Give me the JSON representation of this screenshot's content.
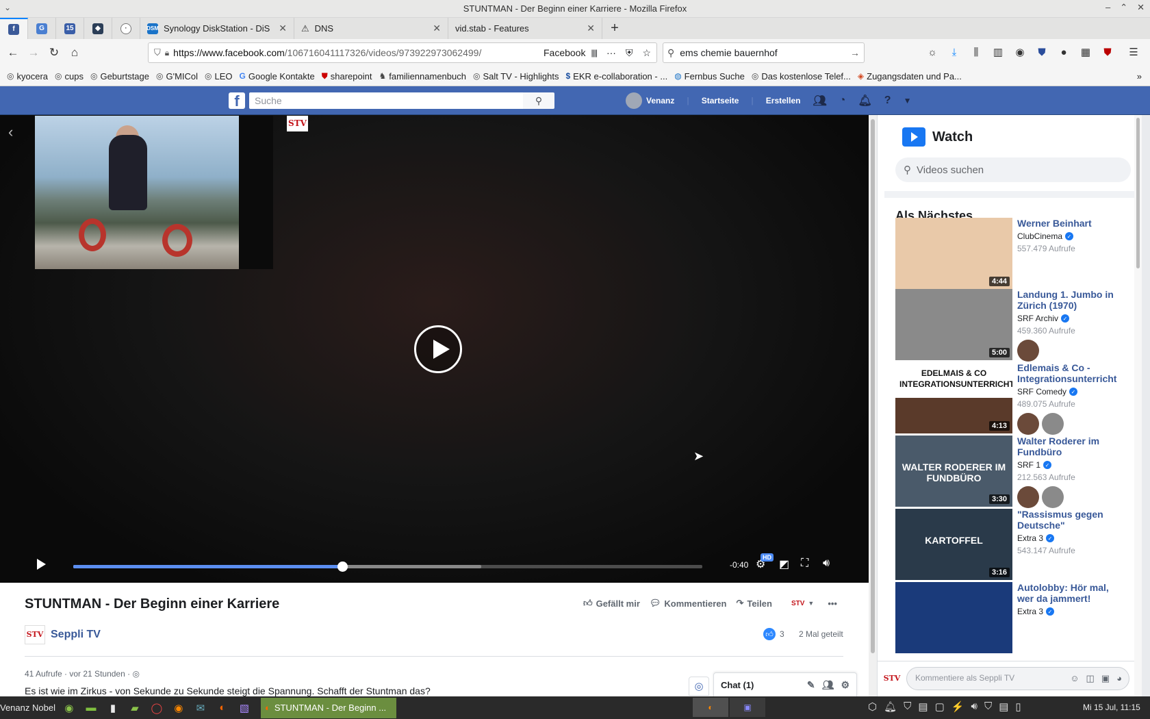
{
  "window": {
    "title": "STUNTMAN - Der Beginn einer Karriere - Mozilla Firefox"
  },
  "tabs": [
    {
      "label": "Synology DiskStation - DiS",
      "close": "✕"
    },
    {
      "label": "DNS",
      "close": "✕"
    },
    {
      "label": "vid.stab - Features",
      "close": "✕"
    }
  ],
  "pinned_tabs": [
    {
      "icon": "facebook-icon",
      "glyph": "f",
      "color": "#3b5998"
    },
    {
      "icon": "gs-icon",
      "glyph": "G",
      "color": "#4a7fd1"
    },
    {
      "icon": "calendar-icon",
      "glyph": "15",
      "color": "#3a5ea8"
    },
    {
      "icon": "codeberg-icon",
      "glyph": "◆",
      "color": "#2b3e57"
    },
    {
      "icon": "globe-icon",
      "glyph": "◎",
      "color": "#666666"
    }
  ],
  "navbar": {
    "url_host": "https://www.facebook.com",
    "url_path": "/106716041117326/videos/973922973062499/",
    "site_label": "Facebook",
    "search_value": "ems chemie bauernhof"
  },
  "bookmarks": [
    {
      "label": "kyocera"
    },
    {
      "label": "cups"
    },
    {
      "label": "Geburtstage"
    },
    {
      "label": "G'MICol"
    },
    {
      "label": "LEO"
    },
    {
      "label": "Google Kontakte"
    },
    {
      "label": "sharepoint"
    },
    {
      "label": "familiennamenbuch"
    },
    {
      "label": "Salt TV - Highlights"
    },
    {
      "label": "EKR e-collaboration - ..."
    },
    {
      "label": "Fernbus Suche"
    },
    {
      "label": "Das kostenlose Telef..."
    },
    {
      "label": "Zugangsdaten und Pa..."
    }
  ],
  "fb": {
    "search_placeholder": "Suche",
    "user_name": "Venanz",
    "nav_home": "Startseite",
    "nav_create": "Erstellen"
  },
  "player": {
    "logo_text": "STV",
    "time_remaining": "-0:40",
    "hd_label": "HD",
    "progress_played": 0.428,
    "progress_buffered": 0.648
  },
  "video_info": {
    "title": "STUNTMAN - Der Beginn einer Karriere",
    "like_label": "Gefällt mir",
    "comment_label": "Kommentieren",
    "share_label": "Teilen",
    "channel_logo": "STV",
    "channel_name": "Seppli TV",
    "reaction_count": "3",
    "shares": "2 Mal geteilt",
    "meta": "41 Aufrufe · vor 21 Stunden ·",
    "description": "Es ist wie im Zirkus - von Sekunde zu Sekunde steigt die Spannung. Schafft der Stuntman das?"
  },
  "chat": {
    "label": "Chat (1)"
  },
  "sidebar": {
    "watch_title": "Watch",
    "search_placeholder": "Videos suchen",
    "next_title": "Als Nächstes",
    "videos": [
      {
        "title": "Werner Beinhart",
        "channel": "ClubCinema",
        "views": "557.479 Aufrufe",
        "duration": "4:44",
        "thumb_color": "#e9c9a9",
        "avatars": 0
      },
      {
        "title": "Landung 1. Jumbo in Zürich (1970)",
        "channel": "SRF Archiv",
        "views": "459.360 Aufrufe",
        "duration": "5:00",
        "thumb_color": "#8a8a8a",
        "avatars": 1
      },
      {
        "title": "Edlemais & Co - Integrationsunterricht",
        "channel": "SRF Comedy",
        "views": "489.075 Aufrufe",
        "duration": "4:13",
        "thumb_color": "#5a3a2a",
        "thumb_text": "EDELMAIS & CO INTEGRATIONSUNTERRICHT",
        "avatars": 2
      },
      {
        "title": "Walter Roderer im Fundbüro",
        "channel": "SRF 1",
        "views": "212.563 Aufrufe",
        "duration": "3:30",
        "thumb_color": "#4a5a6a",
        "thumb_text": "WALTER RODERER IM FUNDBÜRO",
        "avatars": 2
      },
      {
        "title": "\"Rassismus gegen Deutsche\"",
        "channel": "Extra 3",
        "views": "543.147 Aufrufe",
        "duration": "3:16",
        "thumb_color": "#2a3a4a",
        "thumb_text": "KARTOFFEL",
        "avatars": 0
      },
      {
        "title": "Autolobby: Hör mal, wer da jammert!",
        "channel": "Extra 3",
        "views": "",
        "duration": "",
        "thumb_color": "#1a3a7a",
        "avatars": 0
      }
    ],
    "comment_logo": "STV",
    "comment_placeholder": "Kommentiere als Seppli TV"
  },
  "taskbar": {
    "user": "Venanz Nobel",
    "window_label": "STUNTMAN - Der Beginn ...",
    "clock": "Mi 15 Jul, 11:15"
  }
}
